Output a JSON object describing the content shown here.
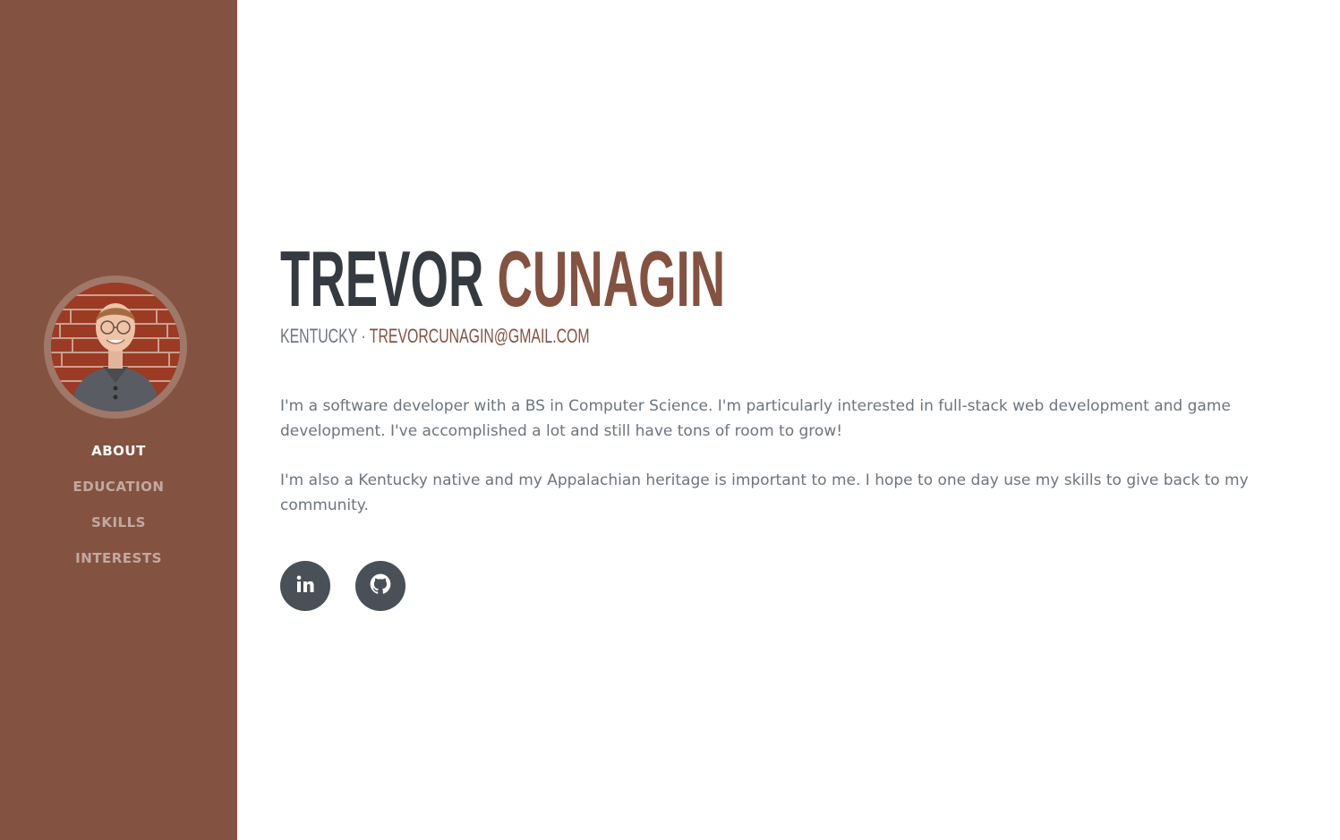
{
  "profile": {
    "first_name": "TREVOR",
    "last_name": "CUNAGIN",
    "location": "KENTUCKY",
    "separator": "·",
    "email": "TREVORCUNAGIN@GMAIL.COM"
  },
  "nav": {
    "items": [
      {
        "label": "ABOUT",
        "active": true
      },
      {
        "label": "EDUCATION",
        "active": false
      },
      {
        "label": "SKILLS",
        "active": false
      },
      {
        "label": "INTERESTS",
        "active": false
      }
    ]
  },
  "about": {
    "paragraph1": "I'm a software developer with a BS in Computer Science. I'm particularly interested in full-stack web development and game development. I've accomplished a lot and still have tons of room to grow!",
    "paragraph2": "I'm also a Kentucky native and my Appalachian heritage is important to me. I hope to one day use my skills to give back to my community."
  },
  "social": [
    {
      "icon": "linkedin-icon"
    },
    {
      "icon": "github-icon"
    }
  ],
  "colors": {
    "primary": "#845241",
    "heading": "#343a40",
    "text": "#6c757d",
    "social_bg": "#495057"
  }
}
